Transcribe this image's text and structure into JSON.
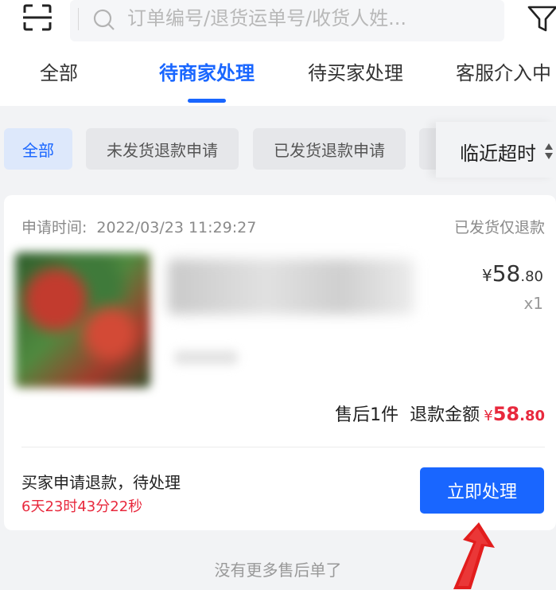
{
  "header": {
    "search_placeholder": "订单编号/退货运单号/收货人姓...",
    "icons": {
      "scan": "scan-icon",
      "search": "search-icon",
      "filter": "filter-icon"
    }
  },
  "tabs": [
    {
      "label": "全部",
      "active": false
    },
    {
      "label": "待商家处理",
      "active": true
    },
    {
      "label": "待买家处理",
      "active": false
    },
    {
      "label": "客服介入中",
      "active": false
    }
  ],
  "filters": {
    "chips": [
      {
        "label": "全部",
        "active": true
      },
      {
        "label": "未发货退款申请",
        "active": false
      },
      {
        "label": "已发货退款申请",
        "active": false
      }
    ],
    "sort_label": "临近超时",
    "sort_icon": "sort-arrows-icon"
  },
  "order": {
    "apply_time_label": "申请时间:",
    "apply_time": "2022/03/23 11:29:27",
    "refund_type": "已发货仅退款",
    "price": {
      "symbol": "¥",
      "integer": "58",
      "decimal": ".80"
    },
    "quantity": "x1",
    "aftersale_count": "售后1件",
    "refund_label": "退款金额",
    "refund_amount": {
      "symbol": "¥",
      "integer": "58",
      "decimal": ".80"
    },
    "status_text": "买家申请退款，待处理",
    "countdown": "6天23时43分22秒",
    "action_label": "立即处理"
  },
  "footer": {
    "no_more": "没有更多售后单了"
  },
  "colors": {
    "accent": "#1966ff",
    "danger": "#e8293d",
    "background": "#f2f3f5",
    "annotation_arrow": "#e21d1d"
  }
}
